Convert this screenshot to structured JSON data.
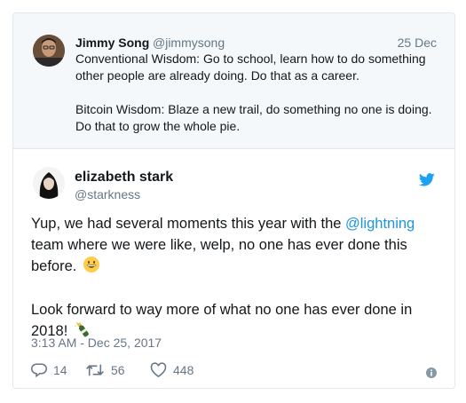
{
  "quoted_tweet": {
    "author_name": "Jimmy Song",
    "author_handle": "@jimmysong",
    "date": "25 Dec",
    "paragraphs": [
      "Conventional Wisdom: Go to school, learn how to do something other people are already doing. Do that as a career.",
      "Bitcoin Wisdom: Blaze a new trail, do something no one is doing. Do that to grow the whole pie."
    ]
  },
  "tweet": {
    "author_name": "elizabeth stark",
    "author_handle": "@starkness",
    "text_before_link": "Yup, we had several moments this year with the ",
    "link_text": "@lightning",
    "text_after_link": " team where we were like, welp, no one has ever done this before.",
    "text_second": "Look forward to way more of what no one has ever done in 2018!",
    "timestamp": "3:13 AM - Dec 25, 2017"
  },
  "actions": {
    "replies": "14",
    "retweets": "56",
    "likes": "448"
  },
  "icons": {
    "reply": "reply-icon",
    "retweet": "retweet-icon",
    "like": "heart-icon",
    "info": "info-icon",
    "brand": "twitter-bird-icon",
    "emoji1": "grinning-face-emoji",
    "emoji2": "champagne-bottle-emoji"
  },
  "colors": {
    "link": "#1b95e0",
    "secondary_text": "#657786",
    "quoted_background": "#f5f8fa",
    "border": "#e1e8ed"
  }
}
